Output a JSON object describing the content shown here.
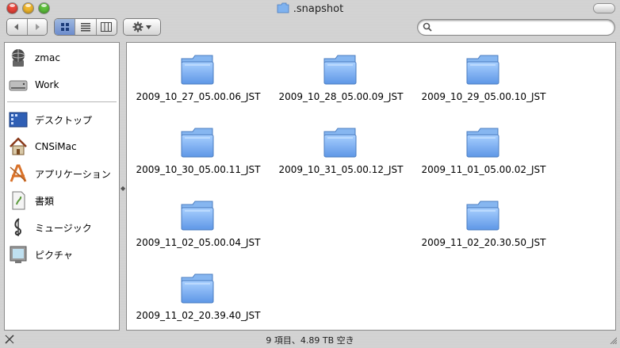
{
  "window": {
    "title": ".snapshot"
  },
  "toolbar": {
    "back_icon": "back-arrow-icon",
    "forward_icon": "forward-arrow-icon",
    "view_modes": [
      "icon-view",
      "list-view",
      "column-view"
    ],
    "active_view": "icon-view",
    "action_icon": "gear-icon",
    "search": {
      "value": "",
      "placeholder": ""
    }
  },
  "sidebar": {
    "items": [
      {
        "label": "zmac",
        "icon": "network-disk-icon"
      },
      {
        "label": "Work",
        "icon": "hard-drive-icon"
      },
      {
        "label": "デスクトップ",
        "icon": "desktop-icon"
      },
      {
        "label": "CNSiMac",
        "icon": "home-icon"
      },
      {
        "label": "アプリケーション",
        "icon": "applications-icon"
      },
      {
        "label": "書類",
        "icon": "documents-icon"
      },
      {
        "label": "ミュージック",
        "icon": "music-icon"
      },
      {
        "label": "ピクチャ",
        "icon": "pictures-icon"
      }
    ]
  },
  "main": {
    "folders": [
      "2009_10_27_05.00.06_JST",
      "2009_10_28_05.00.09_JST",
      "2009_10_29_05.00.10_JST",
      "2009_10_30_05.00.11_JST",
      "2009_10_31_05.00.12_JST",
      "2009_11_01_05.00.02_JST",
      "2009_11_02_05.00.04_JST",
      "2009_11_02_20.30.50_JST",
      "2009_11_02_20.39.40_JST"
    ]
  },
  "status": {
    "text": "9 項目、4.89 TB 空き"
  },
  "colors": {
    "selected_view": "#7e9bd6",
    "folder_blue": "#7fb2ef",
    "close": "#e8443a",
    "minimize": "#f0b62c",
    "zoom": "#5cbf3b"
  }
}
